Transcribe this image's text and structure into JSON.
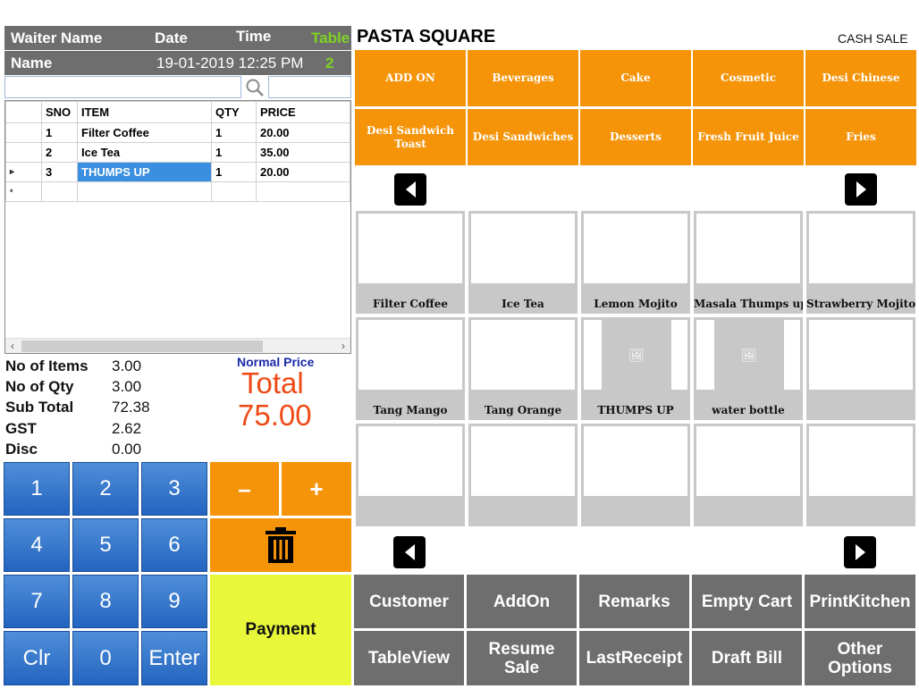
{
  "header": {
    "waiter_label": "Waiter Name",
    "date_label": "Date",
    "time_label": "Time",
    "table_label": "Table",
    "waiter_value": "Name",
    "datetime_value": "19-01-2019 12:25 PM",
    "table_value": "2"
  },
  "search": {
    "placeholder": ""
  },
  "grid": {
    "columns": [
      "SNO",
      "ITEM",
      "QTY",
      "PRICE"
    ],
    "rows": [
      {
        "sno": "1",
        "item": "Filter Coffee",
        "qty": "1",
        "price": "20.00"
      },
      {
        "sno": "2",
        "item": "Ice Tea",
        "qty": "1",
        "price": "35.00"
      },
      {
        "sno": "3",
        "item": "THUMPS UP",
        "qty": "1",
        "price": "20.00"
      }
    ],
    "current_row_marker": "▸",
    "new_row_marker": "*"
  },
  "totals": {
    "items_label": "No of Items",
    "items_value": "3.00",
    "qty_label": "No of Qty",
    "qty_value": "3.00",
    "subtotal_label": "Sub Total",
    "subtotal_value": "72.38",
    "gst_label": "GST",
    "gst_value": "2.62",
    "disc_label": "Disc",
    "disc_value": "0.00",
    "price_mode": "Normal Price",
    "total_label": "Total",
    "total_value": "75.00"
  },
  "keypad": {
    "keys": [
      "1",
      "2",
      "3",
      "4",
      "5",
      "6",
      "7",
      "8",
      "9",
      "Clr",
      "0",
      "Enter"
    ],
    "minus": "–",
    "plus": "+",
    "payment": "Payment"
  },
  "shop": {
    "title": "PASTA SQUARE",
    "sale_type": "CASH SALE"
  },
  "categories": [
    "ADD ON",
    "Beverages",
    "Cake",
    "Cosmetic",
    "Desi Chinese",
    "Desi Sandwich Toast",
    "Desi Sandwiches",
    "Desserts",
    "Fresh Fruit Juice",
    "Fries"
  ],
  "products": [
    "Filter Coffee",
    "Ice Tea",
    "Lemon Mojito",
    "Masala Thumps up",
    "Strawberry Mojito",
    "Tang Mango",
    "Tang Orange",
    "THUMPS UP",
    "water bottle",
    "",
    "",
    "",
    "",
    "",
    ""
  ],
  "actions": [
    "Customer",
    "AddOn",
    "Remarks",
    "Empty Cart",
    "PrintKitchen",
    "TableView",
    "Resume Sale",
    "LastReceipt",
    "Draft Bill",
    "Other Options"
  ],
  "colors": {
    "orange": "#f59409",
    "blue_key": "#2f73cc",
    "gray_button": "#6e6e6e",
    "payment": "#e8f73a",
    "total_red": "#ee4a16",
    "table_green": "#7ed321"
  }
}
